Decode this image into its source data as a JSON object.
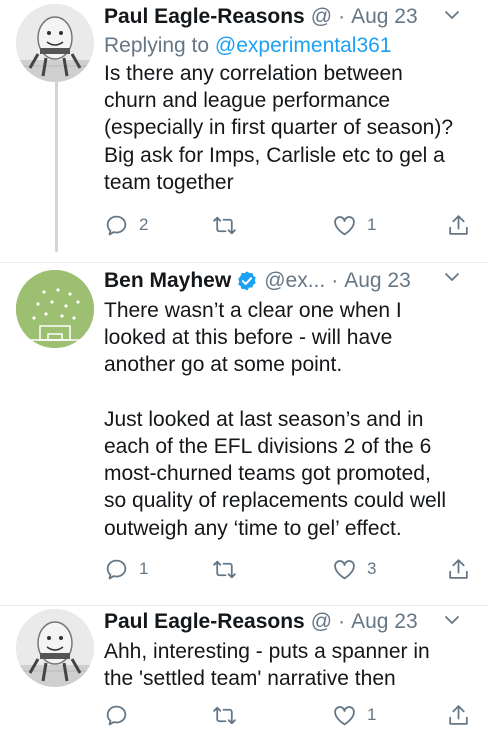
{
  "tweets": [
    {
      "name": "Paul Eagle-Reasons",
      "handle": "@",
      "separator": "·",
      "time": "Aug 23",
      "reply_prefix": "Replying to",
      "reply_handle": "@experimental361",
      "text": "Is there any correlation between\nchurn and league performance\n(especially in first quarter of season)?\nBig ask for Imps, Carlisle etc to gel a\nteam together",
      "reply_count": "2",
      "retweet_count": "",
      "like_count": "1",
      "avatar_icon": "humpty-dumpty-avatar"
    },
    {
      "name": "Ben Mayhew",
      "handle": "@ex...",
      "separator": "·",
      "time": "Aug 23",
      "verified": true,
      "text": "There wasn’t a clear one when I\nlooked at this before - will have\nanother go at some point.\n\nJust looked at last season’s and in\neach of the EFL divisions 2 of the 6\nmost-churned teams got promoted,\nso quality of replacements could well\noutweigh any ‘time to gel’ effect.",
      "reply_count": "1",
      "retweet_count": "",
      "like_count": "3",
      "avatar_icon": "football-pitch-avatar"
    },
    {
      "name": "Paul Eagle-Reasons",
      "handle": "@",
      "separator": "·",
      "time": "Aug 23",
      "text": "Ahh, interesting - puts a spanner in\nthe 'settled team' narrative then",
      "reply_count": "",
      "retweet_count": "",
      "like_count": "1",
      "avatar_icon": "humpty-dumpty-avatar"
    }
  ],
  "colors": {
    "text": "#14171a",
    "secondary": "#657786",
    "link": "#1da1f2",
    "verified": "#1da1f2",
    "divider": "#e6ecf0",
    "thread_line": "#ccd6dd"
  }
}
